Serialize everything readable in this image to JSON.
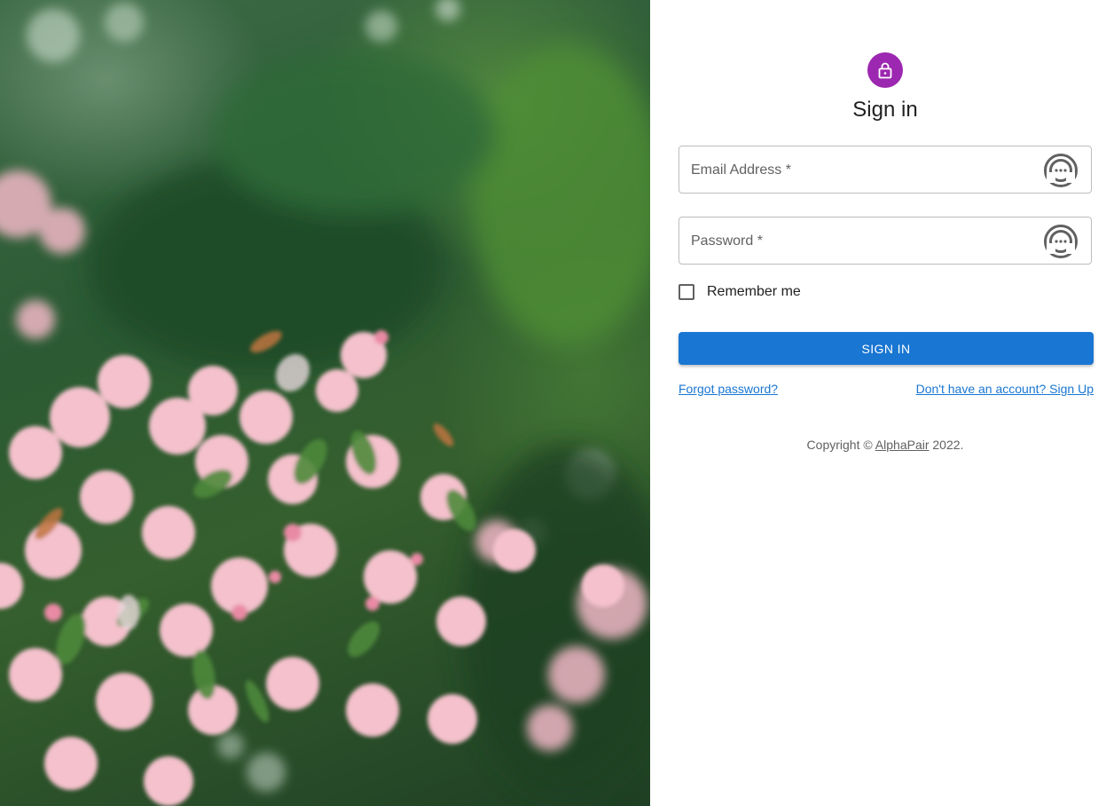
{
  "colors": {
    "avatar": "#9c27b0",
    "primary": "#1976d2",
    "field_border": "#bdbdbd",
    "text": "#212121",
    "muted": "#616161"
  },
  "icons": {
    "avatar": "lock-icon",
    "password_manager": "password-manager-icon"
  },
  "form": {
    "title": "Sign in",
    "email_label": "Email Address *",
    "password_label": "Password *",
    "remember_label": "Remember me",
    "remember_checked": false,
    "submit_label": "SIGN IN",
    "forgot_link": "Forgot password?",
    "signup_link": "Don't have an account? Sign Up"
  },
  "footer": {
    "copyright_prefix": "Copyright © ",
    "brand": "AlphaPair",
    "copyright_suffix": " 2022."
  }
}
